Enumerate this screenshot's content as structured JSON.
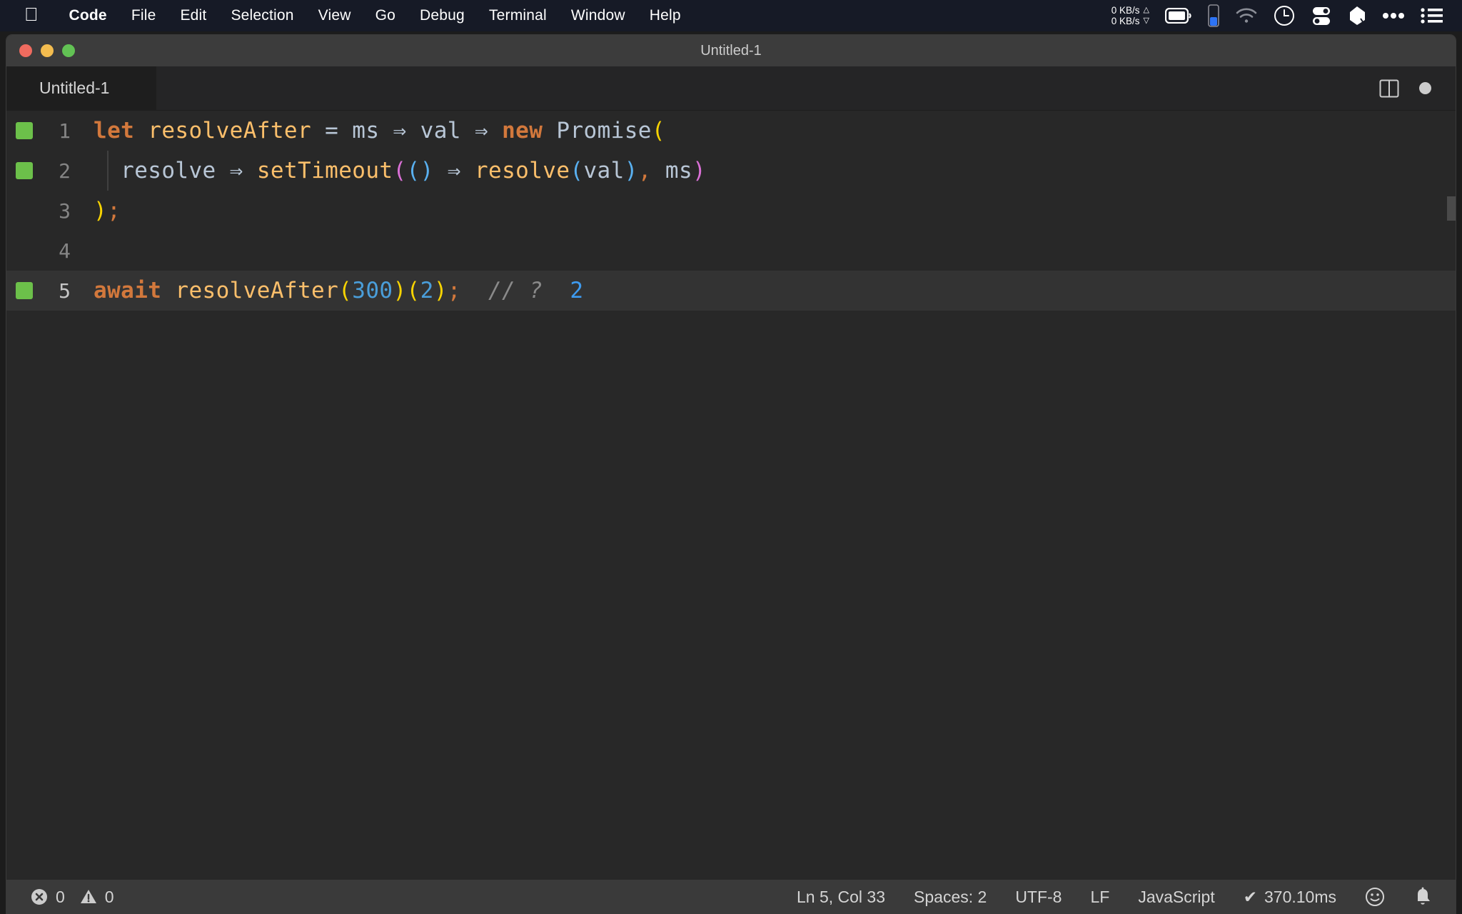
{
  "menubar": {
    "apple_glyph": "",
    "items": [
      {
        "label": "Code",
        "bold": true
      },
      {
        "label": "File",
        "bold": false
      },
      {
        "label": "Edit",
        "bold": false
      },
      {
        "label": "Selection",
        "bold": false
      },
      {
        "label": "View",
        "bold": false
      },
      {
        "label": "Go",
        "bold": false
      },
      {
        "label": "Debug",
        "bold": false
      },
      {
        "label": "Terminal",
        "bold": false
      },
      {
        "label": "Window",
        "bold": false
      },
      {
        "label": "Help",
        "bold": false
      }
    ],
    "network": {
      "upload": "0 KB/s",
      "download": "0 KB/s",
      "up_glyph": "△",
      "down_glyph": "▽"
    },
    "tray": [
      "battery-icon",
      "battery-level-icon",
      "wifi-icon",
      "clock-icon",
      "toggles-icon",
      "bartender-icon",
      "ellipsis-icon",
      "list-icon"
    ]
  },
  "window": {
    "title": "Untitled-1",
    "traffic_lights": [
      "close-button",
      "minimize-button",
      "maximize-button"
    ]
  },
  "tabs": {
    "active_label": "Untitled-1",
    "actions": [
      "split-editor-icon",
      "unsaved-dot-icon"
    ]
  },
  "editor": {
    "lines": [
      {
        "num": "1",
        "breakpoint": true,
        "current": false,
        "indent_guide": false,
        "tokens": [
          {
            "t": "let",
            "c": "kw"
          },
          {
            "t": " ",
            "c": "op"
          },
          {
            "t": "resolveAfter",
            "c": "fn"
          },
          {
            "t": " ",
            "c": "op"
          },
          {
            "t": "=",
            "c": "op"
          },
          {
            "t": " ",
            "c": "op"
          },
          {
            "t": "ms",
            "c": "var"
          },
          {
            "t": " ",
            "c": "op"
          },
          {
            "t": "⇒",
            "c": "op"
          },
          {
            "t": " ",
            "c": "op"
          },
          {
            "t": "val",
            "c": "var"
          },
          {
            "t": " ",
            "c": "op"
          },
          {
            "t": "⇒",
            "c": "op"
          },
          {
            "t": " ",
            "c": "op"
          },
          {
            "t": "new",
            "c": "kw"
          },
          {
            "t": " ",
            "c": "op"
          },
          {
            "t": "Promise",
            "c": "var"
          },
          {
            "t": "(",
            "c": "br-y"
          }
        ]
      },
      {
        "num": "2",
        "breakpoint": true,
        "current": false,
        "indent_guide": true,
        "tokens": [
          {
            "t": "  ",
            "c": "op"
          },
          {
            "t": "resolve",
            "c": "var"
          },
          {
            "t": " ",
            "c": "op"
          },
          {
            "t": "⇒",
            "c": "op"
          },
          {
            "t": " ",
            "c": "op"
          },
          {
            "t": "setTimeout",
            "c": "fn"
          },
          {
            "t": "(",
            "c": "br-m"
          },
          {
            "t": "(",
            "c": "br-b"
          },
          {
            "t": ")",
            "c": "br-b"
          },
          {
            "t": " ",
            "c": "op"
          },
          {
            "t": "⇒",
            "c": "op"
          },
          {
            "t": " ",
            "c": "op"
          },
          {
            "t": "resolve",
            "c": "fn"
          },
          {
            "t": "(",
            "c": "br-b"
          },
          {
            "t": "val",
            "c": "var"
          },
          {
            "t": ")",
            "c": "br-b"
          },
          {
            "t": ",",
            "c": "punc"
          },
          {
            "t": " ",
            "c": "op"
          },
          {
            "t": "ms",
            "c": "var"
          },
          {
            "t": ")",
            "c": "br-m"
          }
        ]
      },
      {
        "num": "3",
        "breakpoint": false,
        "current": false,
        "indent_guide": false,
        "tokens": [
          {
            "t": ")",
            "c": "br-y"
          },
          {
            "t": ";",
            "c": "punc"
          }
        ]
      },
      {
        "num": "4",
        "breakpoint": false,
        "current": false,
        "indent_guide": false,
        "tokens": []
      },
      {
        "num": "5",
        "breakpoint": true,
        "current": true,
        "indent_guide": false,
        "tokens": [
          {
            "t": "await",
            "c": "kw"
          },
          {
            "t": " ",
            "c": "op"
          },
          {
            "t": "resolveAfter",
            "c": "fn"
          },
          {
            "t": "(",
            "c": "br-y"
          },
          {
            "t": "300",
            "c": "num"
          },
          {
            "t": ")",
            "c": "br-y"
          },
          {
            "t": "(",
            "c": "br-y"
          },
          {
            "t": "2",
            "c": "num"
          },
          {
            "t": ")",
            "c": "br-y"
          },
          {
            "t": ";",
            "c": "punc"
          },
          {
            "t": "  ",
            "c": "op"
          },
          {
            "t": "// ?",
            "c": "cmt"
          },
          {
            "t": "  ",
            "c": "op"
          },
          {
            "t": "2",
            "c": "result"
          }
        ]
      }
    ]
  },
  "statusbar": {
    "errors": "0",
    "warnings": "0",
    "cursor": "Ln 5, Col 33",
    "indent": "Spaces: 2",
    "encoding": "UTF-8",
    "eol": "LF",
    "language": "JavaScript",
    "quokka_check": "✔",
    "quokka_time": "370.10ms",
    "feedback_icon": "smiley-icon",
    "notifications_icon": "bell-icon"
  },
  "colors": {
    "accent_green": "#6cc04a",
    "editor_bg": "#282828",
    "statusbar_bg": "#3a3a3a",
    "titlebar_bg": "#3c3c3c"
  }
}
